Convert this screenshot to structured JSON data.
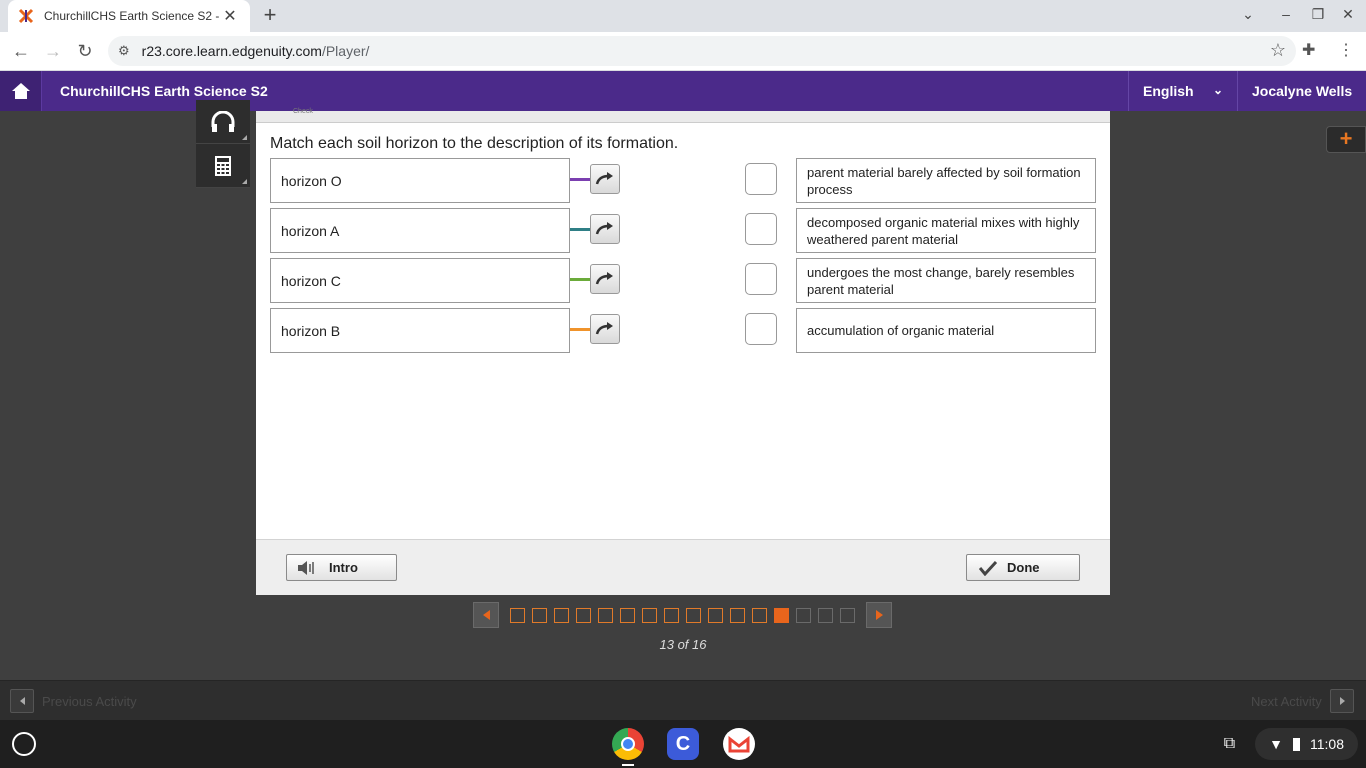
{
  "browser": {
    "tab_title": "ChurchillCHS Earth Science S2 -",
    "url_host": "r23.core.learn.edgenuity.com",
    "url_path": "/Player/"
  },
  "app": {
    "course_title": "ChurchillCHS Earth Science S2",
    "language": "English",
    "user_name": "Jocalyne Wells",
    "accent_color": "#4b2a8a"
  },
  "activity": {
    "check_label": "Check",
    "prompt": "Match each soil horizon to the description of its formation.",
    "left_items": [
      {
        "label": "horizon O",
        "color": "#7b3fb0"
      },
      {
        "label": "horizon A",
        "color": "#2f7f86"
      },
      {
        "label": "horizon C",
        "color": "#6bab3a"
      },
      {
        "label": "horizon B",
        "color": "#f0932b"
      }
    ],
    "right_items": [
      {
        "label": "parent material barely affected by soil formation process"
      },
      {
        "label": "decomposed organic material mixes with highly weathered parent material"
      },
      {
        "label": "undergoes the most change, barely resembles parent material"
      },
      {
        "label": "accumulation of organic material"
      }
    ],
    "intro_label": "Intro",
    "done_label": "Done"
  },
  "pager": {
    "count_text": "13 of 16",
    "current": 13,
    "total": 16
  },
  "activity_nav": {
    "previous_label": "Previous Activity",
    "next_label": "Next Activity"
  },
  "system": {
    "time": "11:08"
  }
}
